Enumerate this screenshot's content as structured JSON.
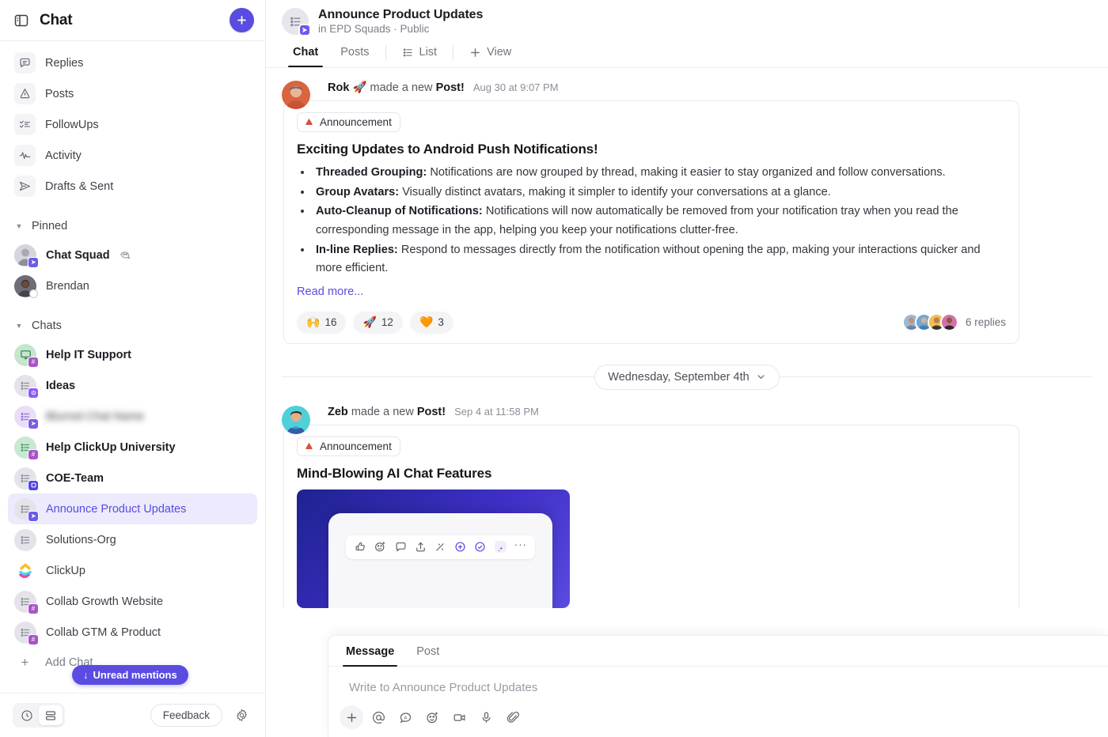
{
  "sidebar": {
    "title": "Chat",
    "panel_icon": "panel-toggle-icon",
    "add_button": "+",
    "nav": [
      {
        "label": "Replies",
        "icon": "replies-icon"
      },
      {
        "label": "Posts",
        "icon": "megaphone-icon"
      },
      {
        "label": "FollowUps",
        "icon": "checklist-icon"
      },
      {
        "label": "Activity",
        "icon": "activity-pulse-icon"
      },
      {
        "label": "Drafts & Sent",
        "icon": "send-icon"
      }
    ],
    "pinned": {
      "label": "Pinned",
      "items": [
        {
          "label": "Chat Squad",
          "unread": true,
          "suffix_icon": "chat-bubble-icon",
          "badge": "send",
          "badge_color": "#6b5ce7",
          "avatar": "person-grey"
        },
        {
          "label": "Brendan",
          "unread": false,
          "badge": "status",
          "avatar": "person-brendan"
        }
      ]
    },
    "chats": {
      "label": "Chats",
      "items": [
        {
          "label": "Help IT Support",
          "unread": true,
          "badge": "hash",
          "badge_color": "#a855c8",
          "avatar": "green-screen"
        },
        {
          "label": "Ideas",
          "unread": true,
          "badge": "power",
          "badge_color": "#8b5cf6",
          "avatar": "grey-list"
        },
        {
          "label": "Blurred Chat Name",
          "unread": false,
          "blurred": true,
          "badge": "send",
          "badge_color": "#7c5ce0",
          "avatar": "purple-list"
        },
        {
          "label": "Help ClickUp University",
          "unread": true,
          "badge": "hash",
          "badge_color": "#a855c8",
          "avatar": "green-list"
        },
        {
          "label": "COE-Team",
          "unread": true,
          "badge": "box",
          "badge_color": "#4f46e5",
          "avatar": "grey-list"
        },
        {
          "label": "Announce Product Updates",
          "unread": false,
          "active": true,
          "badge": "send",
          "badge_color": "#6b5ce7",
          "avatar": "grey-list"
        },
        {
          "label": "Solutions-Org",
          "unread": false,
          "badge": "none",
          "avatar": "grey-list"
        },
        {
          "label": "ClickUp",
          "unread": false,
          "badge": "none",
          "avatar": "clickup-logo"
        },
        {
          "label": "Collab Growth Website",
          "unread": false,
          "badge": "hash",
          "badge_color": "#a855c8",
          "avatar": "grey-list"
        },
        {
          "label": "Collab GTM & Product",
          "unread": false,
          "badge": "hash",
          "badge_color": "#a855c8",
          "avatar": "grey-list"
        }
      ]
    },
    "add_chat": "Add Chat",
    "unread_mentions": "Unread mentions",
    "footer": {
      "history_icon": "clock-icon",
      "list_icon": "stacked-rows-icon",
      "feedback": "Feedback",
      "settings_icon": "gear-icon"
    }
  },
  "header": {
    "title": "Announce Product Updates",
    "subtitle": "in EPD Squads · Public",
    "tabs": [
      {
        "label": "Chat",
        "active": true
      },
      {
        "label": "Posts",
        "active": false
      },
      {
        "label": "List",
        "active": false,
        "icon": "list-icon"
      },
      {
        "label": "View",
        "active": false,
        "icon": "plus-icon"
      }
    ]
  },
  "feed": {
    "posts": [
      {
        "author": "Rok",
        "author_emoji": "🚀",
        "action": "made a new",
        "action_bold": "Post!",
        "time": "Aug 30 at 9:07 PM",
        "badge": "Announcement",
        "heading": "Exciting Updates to Android Push Notifications!",
        "bullets": [
          {
            "lead": "Threaded Grouping:",
            "text": " Notifications are now grouped by thread, making it easier to stay organized and follow conversations."
          },
          {
            "lead": "Group Avatars:",
            "text": " Visually distinct avatars, making it simpler to identify your conversations at a glance."
          },
          {
            "lead": "Auto-Cleanup of Notifications:",
            "text": " Notifications will now automatically be removed from your notification tray when you read the corresponding message in the app, helping you keep your notifications clutter-free."
          },
          {
            "lead": "In-line Replies:",
            "text": " Respond to messages directly from the notification without opening the app, making your interactions quicker and more efficient."
          }
        ],
        "read_more": "Read more...",
        "reactions": [
          {
            "emoji": "🙌",
            "count": "16"
          },
          {
            "emoji": "🚀",
            "count": "12"
          },
          {
            "emoji": "🧡",
            "count": "3"
          }
        ],
        "replies_text": "6 replies"
      },
      {
        "author": "Zeb",
        "author_emoji": "",
        "action": "made a new",
        "action_bold": "Post!",
        "time": "Sep 4 at 11:58 PM",
        "badge": "Announcement",
        "heading": "Mind-Blowing AI Chat Features"
      }
    ],
    "date_divider": "Wednesday, September 4th"
  },
  "composer": {
    "tabs": [
      {
        "label": "Message",
        "active": true
      },
      {
        "label": "Post",
        "active": false
      }
    ],
    "placeholder": "Write to Announce Product Updates",
    "tools": [
      "plus-icon",
      "mention-at-icon",
      "ai-assist-icon",
      "emoji-icon",
      "video-icon",
      "microphone-icon",
      "attachment-clip-icon"
    ]
  },
  "colors": {
    "accent": "#5a4ce0",
    "accent_soft": "#eceafc",
    "announcement_red": "#d94f3d",
    "text": "#17171c",
    "muted": "#7d7d89"
  }
}
